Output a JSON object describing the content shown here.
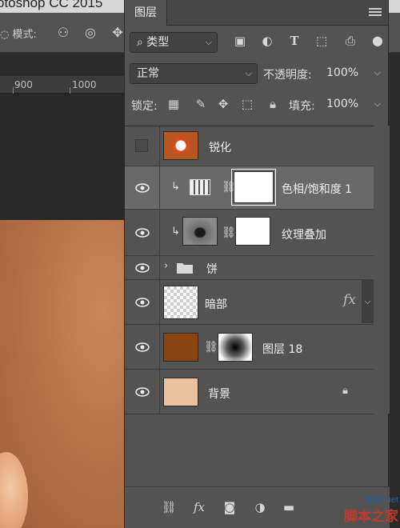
{
  "app": {
    "title_fragment": "otoshop CC 2015",
    "mode_label": "模式:",
    "ruler_ticks": [
      "900",
      "1000"
    ]
  },
  "panel": {
    "tab_label": "图层",
    "filter_kind": "类型",
    "blend_mode": "正常",
    "opacity_label": "不透明度:",
    "opacity_value": "100%",
    "lock_label": "锁定:",
    "fill_label": "填充:",
    "fill_value": "100%",
    "filter_icons": [
      "image-filter-icon",
      "adjustment-filter-icon",
      "type-filter-icon",
      "shape-filter-icon",
      "smart-object-filter-icon",
      "filter-toggle-icon"
    ],
    "lock_icons": [
      "lock-transparent-icon",
      "lock-image-icon",
      "lock-position-icon",
      "lock-artboard-icon",
      "lock-all-icon"
    ]
  },
  "layers": [
    {
      "name": "锐化",
      "visible": false,
      "thumb_color": "#b8561f"
    },
    {
      "name": "色相/饱和度 1",
      "visible": true,
      "selected": true,
      "clipped": true,
      "mask_color": "#ffffff"
    },
    {
      "name": "纹理叠加",
      "visible": true,
      "clipped": true,
      "mask_color": "#ffffff"
    },
    {
      "name": "饼",
      "visible": true,
      "group": true
    },
    {
      "name": "暗部",
      "visible": true,
      "fx": "fx"
    },
    {
      "name": "图层 18",
      "visible": true,
      "thumb_color": "#8b4513"
    },
    {
      "name": "背景",
      "visible": true,
      "thumb_color": "#ecc4a2",
      "locked": true
    }
  ],
  "footer_icons": [
    "link-layers-icon",
    "layer-style-icon",
    "add-mask-icon",
    "adjustment-layer-icon",
    "new-group-icon"
  ],
  "watermark": {
    "url": "jb51.net",
    "brand": "脚本之家"
  }
}
